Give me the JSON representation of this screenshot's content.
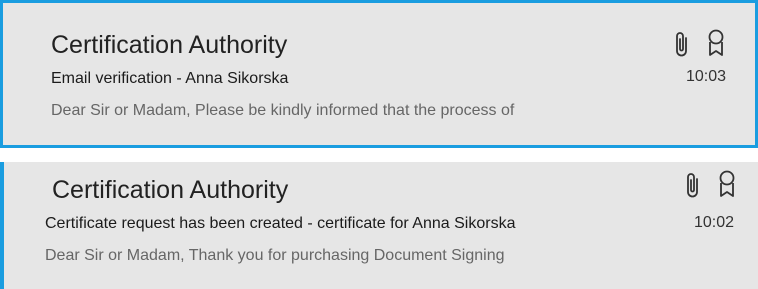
{
  "accent_color": "#1a9de0",
  "emails": [
    {
      "sender": "Certification Authority",
      "subject": "Email verification - Anna Sikorska",
      "preview": "Dear Sir or Madam,  Please be kindly informed that the process of",
      "time": "10:03",
      "icons": [
        "paperclip-icon",
        "ribbon-badge-icon"
      ],
      "selected": true
    },
    {
      "sender": "Certification Authority",
      "subject": "Certificate request has been created - certificate for Anna Sikorska",
      "preview": "Dear Sir or Madam,  Thank you for purchasing Document Signing",
      "time": "10:02",
      "icons": [
        "paperclip-icon",
        "ribbon-badge-icon"
      ],
      "selected": false
    }
  ]
}
